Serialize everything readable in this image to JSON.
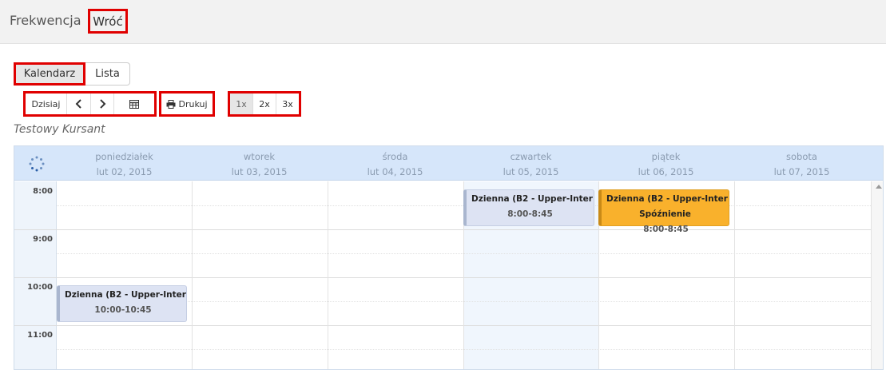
{
  "header": {
    "title": "Frekwencja",
    "back_label": "Wróć"
  },
  "view_toggle": {
    "calendar_label": "Kalendarz",
    "list_label": "Lista"
  },
  "toolbar": {
    "today_label": "Dzisiaj",
    "prev_icon": "chevron-left-icon",
    "next_icon": "chevron-right-icon",
    "calendar_icon": "calendar-grid-icon",
    "print_icon": "printer-icon",
    "print_label": "Drukuj",
    "zoom": [
      "1x",
      "2x",
      "3x"
    ],
    "zoom_selected": "1x"
  },
  "student_name": "Testowy Kursant",
  "calendar": {
    "days": [
      {
        "name": "poniedziałek",
        "date": "lut 02, 2015"
      },
      {
        "name": "wtorek",
        "date": "lut 03, 2015"
      },
      {
        "name": "środa",
        "date": "lut 04, 2015"
      },
      {
        "name": "czwartek",
        "date": "lut 05, 2015"
      },
      {
        "name": "piątek",
        "date": "lut 06, 2015"
      },
      {
        "name": "sobota",
        "date": "lut 07, 2015"
      }
    ],
    "hours": [
      "8:00",
      "9:00",
      "10:00",
      "11:00"
    ],
    "events": [
      {
        "title": "Dzienna (B2 - Upper-Inter",
        "time": "8:00-8:45",
        "day": "czwartek",
        "status": ""
      },
      {
        "title": "Dzienna (B2 - Upper-Inter",
        "status_label": "Spóźnienie",
        "time": "8:00-8:45",
        "day": "piątek"
      },
      {
        "title": "Dzienna (B2 - Upper-Inter",
        "time": "10:00-10:45",
        "day": "poniedziałek",
        "status": ""
      }
    ]
  },
  "colors": {
    "accent_red": "#e00000",
    "late": "#f9b12c",
    "event": "#dde3f3",
    "header_bg": "#d6e6fa"
  }
}
